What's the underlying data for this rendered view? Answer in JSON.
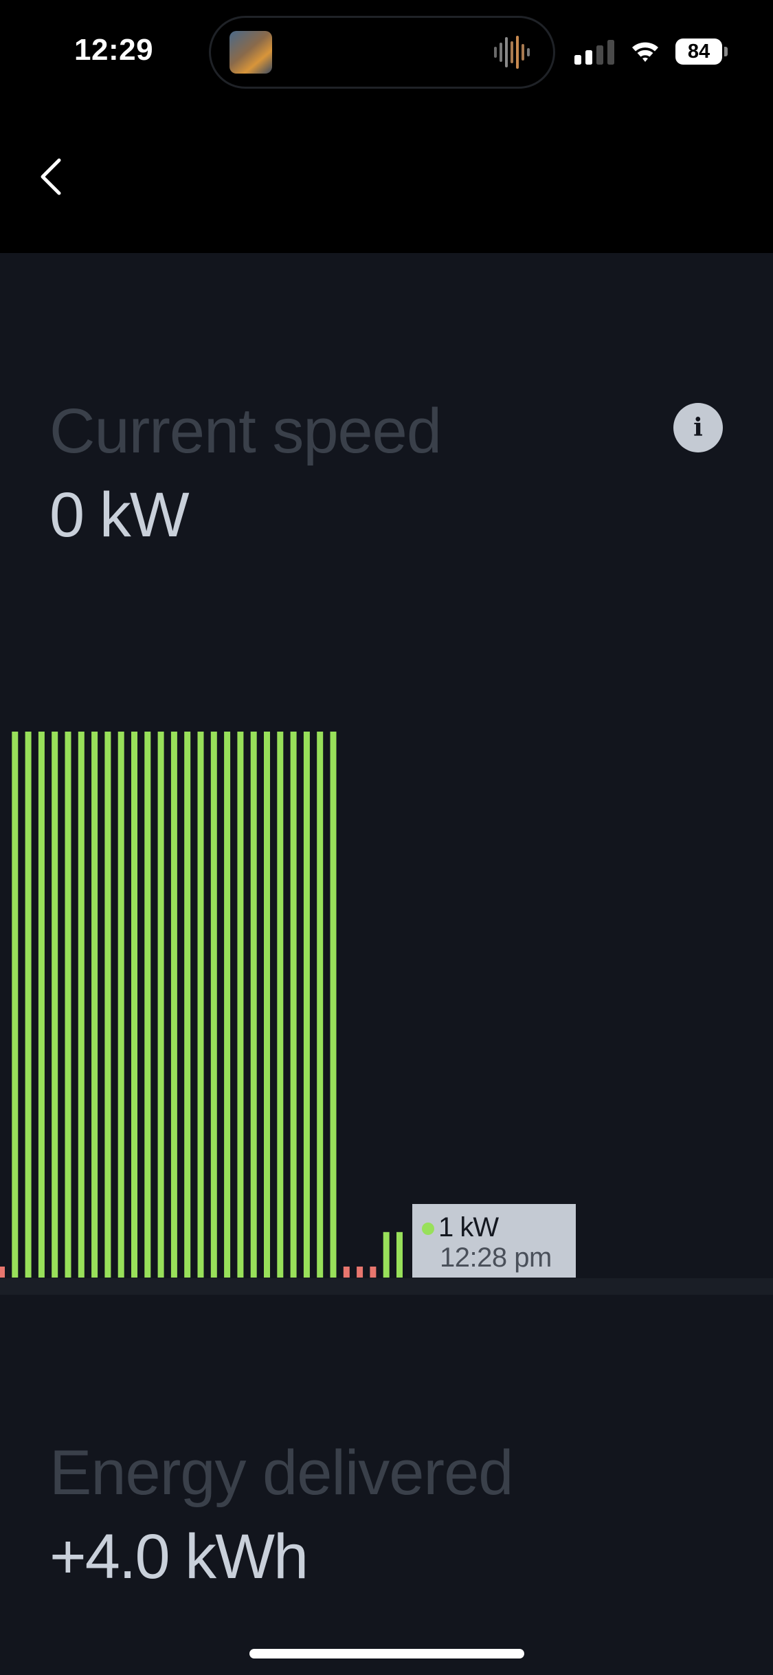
{
  "status_bar": {
    "time": "12:29",
    "battery": "84"
  },
  "header": {
    "back_icon": "chevron-left-icon"
  },
  "current_speed": {
    "label": "Current speed",
    "value": "0 kW"
  },
  "info_button": {
    "label": "i",
    "icon": "info-icon"
  },
  "chart_data": {
    "type": "bar",
    "xlabel": "",
    "ylabel": "",
    "colors": {
      "active": "#98e05a",
      "idle": "#e8766e"
    },
    "bars": [
      {
        "value": 0,
        "color": "idle"
      },
      {
        "value": 12,
        "color": "active"
      },
      {
        "value": 12,
        "color": "active"
      },
      {
        "value": 12,
        "color": "active"
      },
      {
        "value": 12,
        "color": "active"
      },
      {
        "value": 12,
        "color": "active"
      },
      {
        "value": 12,
        "color": "active"
      },
      {
        "value": 12,
        "color": "active"
      },
      {
        "value": 12,
        "color": "active"
      },
      {
        "value": 12,
        "color": "active"
      },
      {
        "value": 12,
        "color": "active"
      },
      {
        "value": 12,
        "color": "active"
      },
      {
        "value": 12,
        "color": "active"
      },
      {
        "value": 12,
        "color": "active"
      },
      {
        "value": 12,
        "color": "active"
      },
      {
        "value": 12,
        "color": "active"
      },
      {
        "value": 12,
        "color": "active"
      },
      {
        "value": 12,
        "color": "active"
      },
      {
        "value": 12,
        "color": "active"
      },
      {
        "value": 12,
        "color": "active"
      },
      {
        "value": 12,
        "color": "active"
      },
      {
        "value": 12,
        "color": "active"
      },
      {
        "value": 12,
        "color": "active"
      },
      {
        "value": 12,
        "color": "active"
      },
      {
        "value": 12,
        "color": "active"
      },
      {
        "value": 12,
        "color": "active"
      },
      {
        "value": 0,
        "color": "idle"
      },
      {
        "value": 0,
        "color": "idle"
      },
      {
        "value": 0,
        "color": "idle"
      },
      {
        "value": 1,
        "color": "active"
      },
      {
        "value": 1,
        "color": "active"
      }
    ],
    "ylim": [
      0,
      12
    ],
    "tooltip": {
      "value": "1 kW",
      "time": "12:28 pm"
    }
  },
  "energy_delivered": {
    "label": "Energy delivered",
    "value": "+4.0 kWh"
  }
}
